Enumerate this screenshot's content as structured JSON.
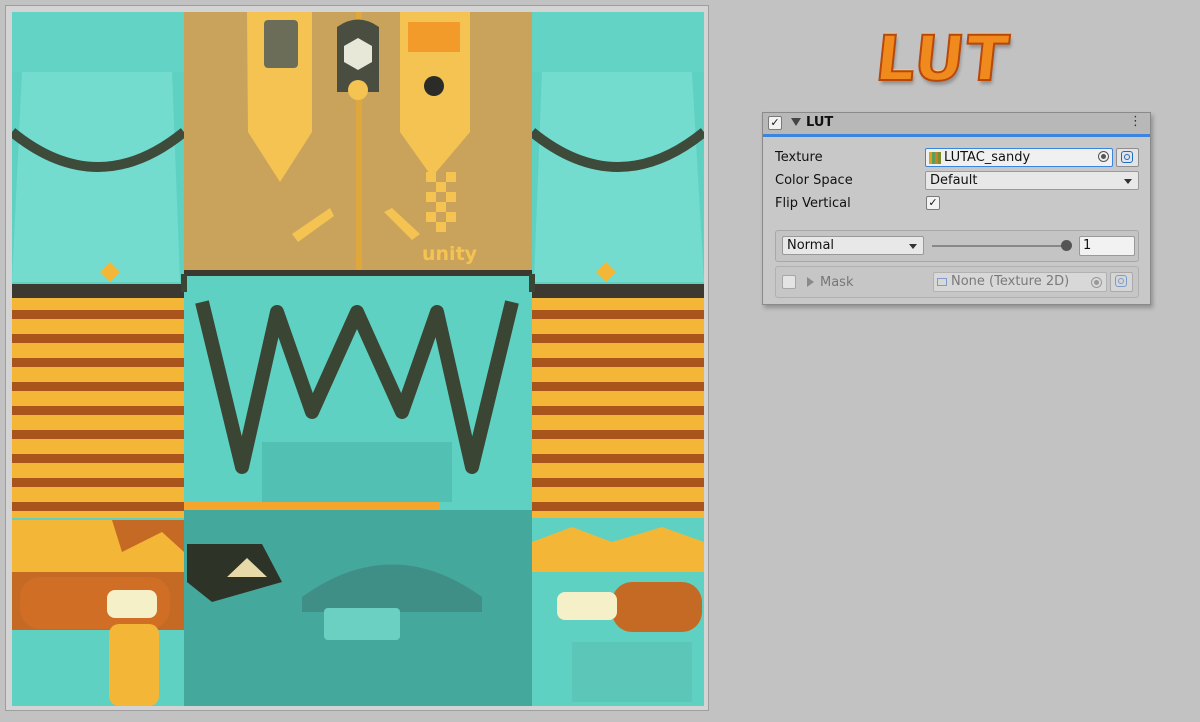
{
  "logo": {
    "text": "LUT"
  },
  "preview": {
    "texture_logo_text": "unity",
    "colors": {
      "teal": "#5fd1c2",
      "tan": "#c9a35c",
      "gold": "#f4b636",
      "stripe_dark": "#a9541a",
      "frame": "#d4d4d4"
    }
  },
  "component": {
    "title": "LUT",
    "enabled": true,
    "menu_icon": "⋮",
    "texture": {
      "label": "Texture",
      "value": "LUTAC_sandy"
    },
    "color_space": {
      "label": "Color Space",
      "value": "Default"
    },
    "flip_vertical": {
      "label": "Flip Vertical",
      "checked": true,
      "check_glyph": "✓"
    },
    "blend": {
      "mode": "Normal",
      "intensity": "1"
    },
    "mask": {
      "label": "Mask",
      "value": "None (Texture 2D)",
      "enabled": false
    },
    "accent_color": "#3b84e0"
  }
}
